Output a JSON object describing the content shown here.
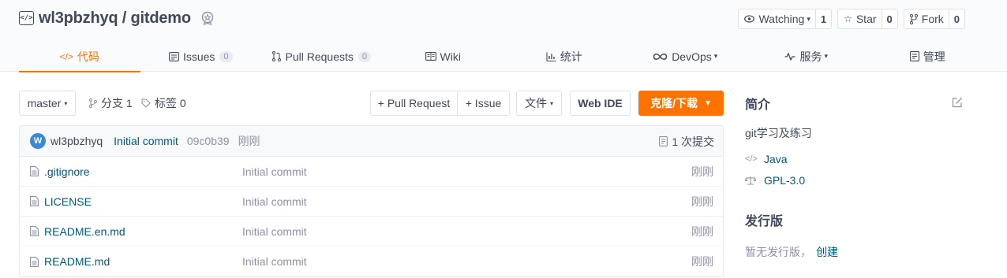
{
  "repo": {
    "full_name": "wl3pbzhyq / gitdemo"
  },
  "actions": {
    "watch": {
      "label": "Watching",
      "count": "1",
      "icon": "eye-icon"
    },
    "star": {
      "label": "Star",
      "count": "0",
      "icon": "star-icon"
    },
    "fork": {
      "label": "Fork",
      "count": "0",
      "icon": "fork-icon"
    }
  },
  "tabs": [
    {
      "label": "代码",
      "icon": "code-icon",
      "active": true
    },
    {
      "label": "Issues",
      "count": "0",
      "icon": "issues-icon"
    },
    {
      "label": "Pull Requests",
      "count": "0",
      "icon": "pull-request-icon"
    },
    {
      "label": "Wiki",
      "icon": "wiki-icon"
    },
    {
      "label": "统计",
      "icon": "stats-icon"
    },
    {
      "label": "DevOps",
      "icon": "devops-icon"
    },
    {
      "label": "服务",
      "icon": "service-icon"
    },
    {
      "label": "管理",
      "icon": "manage-icon"
    }
  ],
  "toolbar": {
    "branch": "master",
    "branches_label": "分支 1",
    "tags_label": "标签 0",
    "pull_request_button": "+ Pull Request",
    "issue_button": "+ Issue",
    "file_button": "文件",
    "web_ide_button": "Web IDE",
    "clone_button": "克隆/下载"
  },
  "latest_commit": {
    "avatar_letter": "W",
    "author": "wl3pbzhyq",
    "message": "Initial commit",
    "hash": "09c0b39",
    "time": "刚刚",
    "commit_count": "1 次提交"
  },
  "files": [
    {
      "name": ".gitignore",
      "message": "Initial commit",
      "time": "刚刚"
    },
    {
      "name": "LICENSE",
      "message": "Initial commit",
      "time": "刚刚"
    },
    {
      "name": "README.en.md",
      "message": "Initial commit",
      "time": "刚刚"
    },
    {
      "name": "README.md",
      "message": "Initial commit",
      "time": "刚刚"
    }
  ],
  "sidebar": {
    "intro_title": "简介",
    "description": "git学习及练习",
    "language": "Java",
    "license": "GPL-3.0",
    "releases_title": "发行版",
    "releases_text": "暂无发行版，",
    "create_link": "创建"
  },
  "colors": {
    "accent": "#fe7300",
    "link": "#005980",
    "text": "#40485b",
    "muted": "#8c92a4"
  }
}
